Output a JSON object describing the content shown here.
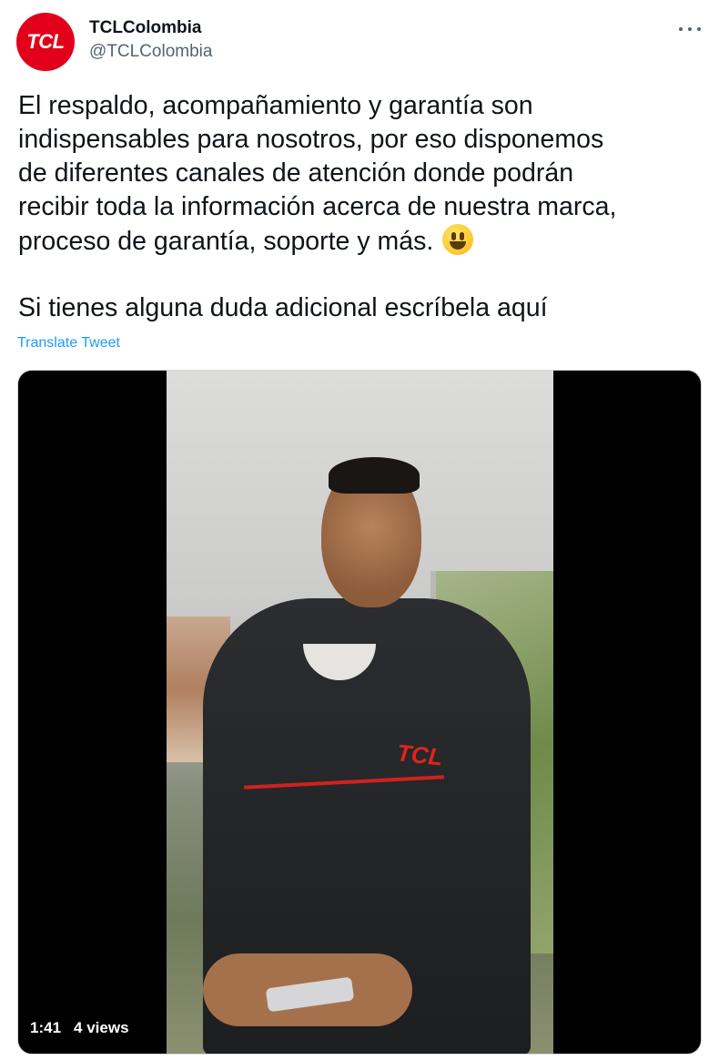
{
  "author": {
    "avatar_text": "TCL",
    "display_name": "TCLColombia",
    "handle": "@TCLColombia"
  },
  "tweet": {
    "paragraph1": "El respaldo, acompañamiento y garantía son\nindispensables para nosotros, por eso disponemos\nde diferentes canales de atención donde podrán\nrecibir toda la información acerca de nuestra marca,\nproceso de garantía, soporte y más.",
    "emoji": "smiling-face-emoji",
    "paragraph2": "Si tienes alguna duda adicional escríbela aquí",
    "translate_label": "Translate Tweet"
  },
  "video": {
    "duration": "1:41",
    "views": "4 views",
    "jacket_logo": "TCL"
  },
  "colors": {
    "brand_red": "#e2001a",
    "link_blue": "#1d9bf0",
    "secondary_text": "#536471"
  }
}
